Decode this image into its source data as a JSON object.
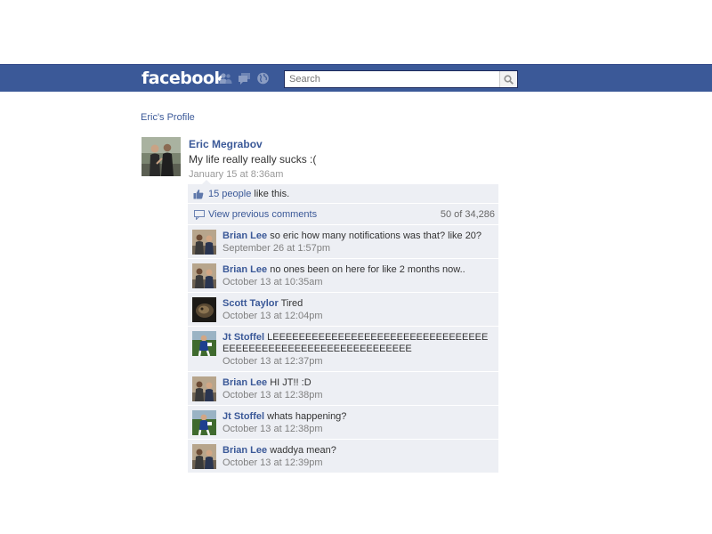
{
  "header": {
    "logo": "facebook",
    "search_placeholder": "Search",
    "jewels": [
      "friends-icon",
      "messages-icon",
      "notifications-globe-icon"
    ],
    "brand_color": "#3b5998"
  },
  "breadcrumb": {
    "profile_link": "Eric's Profile"
  },
  "post": {
    "author": "Eric Megrabov",
    "message": "My life really really sucks :(",
    "timestamp": "January 15 at 8:36am"
  },
  "likes": {
    "count_link": "15 people",
    "suffix": " like this."
  },
  "previous_comments": {
    "label": "View previous comments",
    "count": "50 of 34,286"
  },
  "comments": [
    {
      "author": "Brian Lee",
      "text": "so eric how many notifications was that? like 20?",
      "time": "September 26 at 1:57pm"
    },
    {
      "author": "Brian Lee",
      "text": "no ones been on here for like 2 months now..",
      "time": "October 13 at 10:35am"
    },
    {
      "author": "Scott Taylor",
      "text": "Tired",
      "time": "October 13 at 12:04pm"
    },
    {
      "author": "Jt Stoffel",
      "text": "LEEEEEEEEEEEEEEEEEEEEEEEEEEEEEEEEEEEEEEEEEEEEEEEEEEEEEEEEEEEEEE",
      "time": "October 13 at 12:37pm"
    },
    {
      "author": "Brian Lee",
      "text": "HI JT!! :D",
      "time": "October 13 at 12:38pm"
    },
    {
      "author": "Jt Stoffel",
      "text": "whats happening?",
      "time": "October 13 at 12:38pm"
    },
    {
      "author": "Brian Lee",
      "text": "waddya mean?",
      "time": "October 13 at 12:39pm"
    }
  ]
}
